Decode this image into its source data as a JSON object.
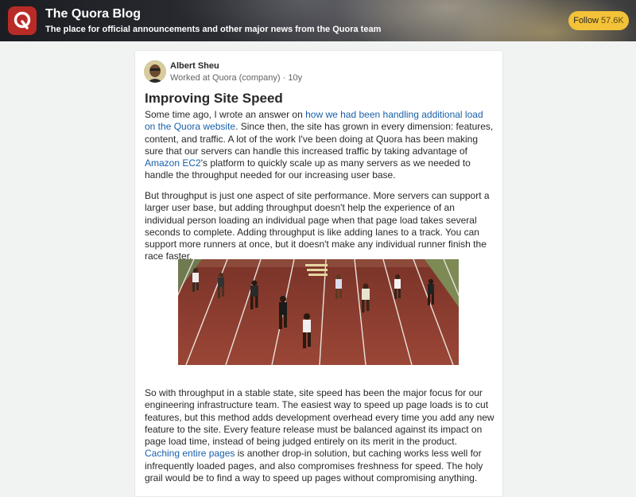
{
  "header": {
    "title": "The Quora Blog",
    "subtitle": "The place for official announcements and other major news from the Quora team",
    "follow_label": "Follow",
    "follow_count": "57.6K"
  },
  "post": {
    "author": "Albert Sheu",
    "meta": "Worked at Quora (company) · 10y",
    "title": "Improving Site Speed",
    "p1": {
      "t1": "Some time ago, I wrote an answer on ",
      "link1": "how we had been handling additional load on the Quora website",
      "t2": ". Since then, the site has grown in every dimension: features, content, and traffic. A lot of the work I've been doing at Quora has been making sure that our servers can handle this increased traffic by taking advantage of ",
      "link2": "Amazon EC2",
      "t3": "'s platform to quickly scale up as many servers as we needed to handle the throughput needed for our increasing user base."
    },
    "p2": "But throughput is just one aspect of site performance. More servers can support a larger user base, but adding throughput doesn't help the experience of an individual person loading an individual page when that page load takes several seconds to complete. Adding throughput is like adding lanes to a track. You can support more runners at once, but it doesn't make any individual runner finish the race faster.",
    "p3": {
      "t1": "So with throughput in a stable state, site speed has been the major focus for our engineering infrastructure team. The easiest way to speed up page loads is to cut features, but this method adds development overhead every time you add any new feature to the site. Every feature release must be balanced against its impact on page load time, instead of being judged entirely on its merit in the product. ",
      "link1": "Caching entire pages",
      "t2": " is another drop-in solution, but caching works less well for infrequently loaded pages, and also compromises freshness for speed. The holy grail would be to find a way to speed up pages without compromising anything."
    }
  },
  "colors": {
    "brand": "#b92b27",
    "follow_button": "#f3c238",
    "link": "#195faa",
    "track": "#8a3a2e"
  }
}
